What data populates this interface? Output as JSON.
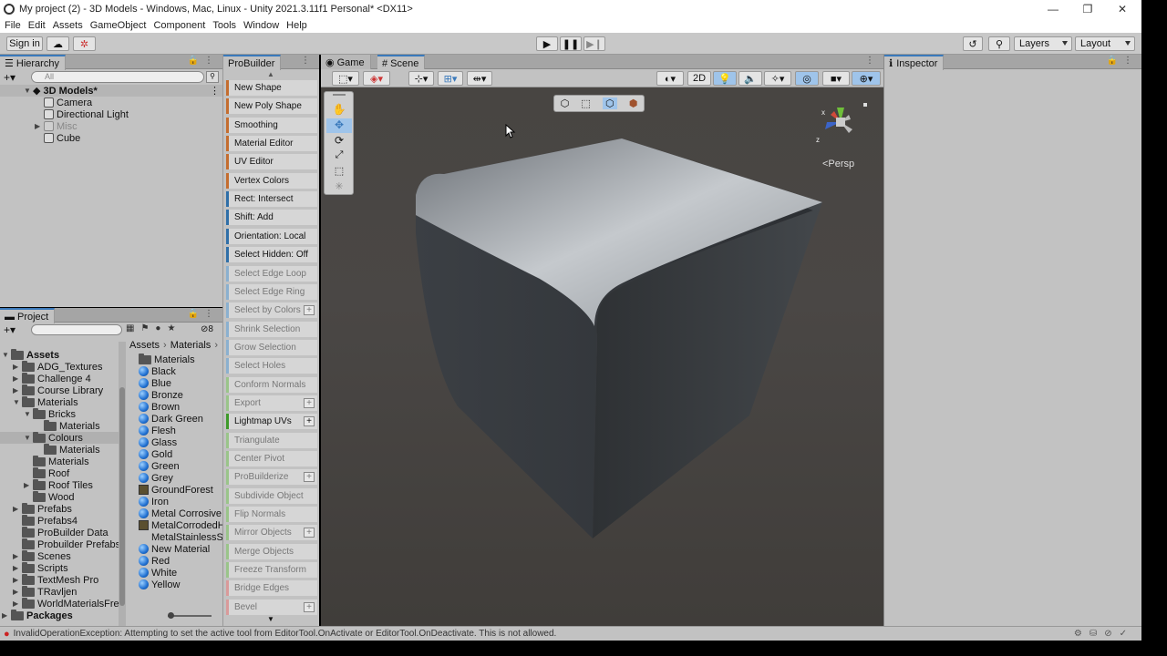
{
  "window": {
    "title": "My project (2) - 3D Models - Windows, Mac, Linux - Unity 2021.3.11f1 Personal* <DX11>",
    "controls": [
      "—",
      "❐",
      "✕"
    ]
  },
  "menu": [
    "File",
    "Edit",
    "Assets",
    "GameObject",
    "Component",
    "Tools",
    "Window",
    "Help"
  ],
  "toolbar": {
    "sign_in": "Sign in",
    "layers": "Layers",
    "layout": "Layout"
  },
  "hierarchy": {
    "tab": "Hierarchy",
    "search_placeholder": "All",
    "scene": "3D Models*",
    "items": [
      "Camera",
      "Directional Light",
      "Misc",
      "Cube"
    ]
  },
  "project": {
    "tab": "Project",
    "count_badge": "8",
    "tree": [
      {
        "label": "Assets",
        "bold": true
      },
      {
        "label": "ADG_Textures"
      },
      {
        "label": "Challenge 4"
      },
      {
        "label": "Course Library"
      },
      {
        "label": "Materials"
      },
      {
        "label": "Bricks"
      },
      {
        "label": "Materials"
      },
      {
        "label": "Colours"
      },
      {
        "label": "Materials"
      },
      {
        "label": "Materials"
      },
      {
        "label": "Roof"
      },
      {
        "label": "Roof Tiles"
      },
      {
        "label": "Wood"
      },
      {
        "label": "Prefabs"
      },
      {
        "label": "Prefabs4"
      },
      {
        "label": "ProBuilder Data"
      },
      {
        "label": "Probuilder Prefabs"
      },
      {
        "label": "Scenes"
      },
      {
        "label": "Scripts"
      },
      {
        "label": "TextMesh Pro"
      },
      {
        "label": "TRavljen"
      },
      {
        "label": "WorldMaterialsFre"
      },
      {
        "label": "Packages",
        "bold": true
      }
    ],
    "breadcrumb": [
      "Assets",
      "Materials"
    ],
    "files": [
      {
        "label": "Materials",
        "kind": "folder"
      },
      {
        "label": "Black",
        "kind": "mat"
      },
      {
        "label": "Blue",
        "kind": "mat"
      },
      {
        "label": "Bronze",
        "kind": "mat"
      },
      {
        "label": "Brown",
        "kind": "mat"
      },
      {
        "label": "Dark Green",
        "kind": "mat"
      },
      {
        "label": "Flesh",
        "kind": "mat"
      },
      {
        "label": "Glass",
        "kind": "mat"
      },
      {
        "label": "Gold",
        "kind": "mat"
      },
      {
        "label": "Green",
        "kind": "mat"
      },
      {
        "label": "Grey",
        "kind": "mat"
      },
      {
        "label": "GroundForest",
        "kind": "tex"
      },
      {
        "label": "Iron",
        "kind": "mat"
      },
      {
        "label": "Metal Corrosive",
        "kind": "mat"
      },
      {
        "label": "MetalCorrodedH",
        "kind": "tex"
      },
      {
        "label": "MetalStainlessSt",
        "kind": "none"
      },
      {
        "label": "New Material",
        "kind": "mat"
      },
      {
        "label": "Red",
        "kind": "mat"
      },
      {
        "label": "White",
        "kind": "mat"
      },
      {
        "label": "Yellow",
        "kind": "mat"
      }
    ]
  },
  "probuilder": {
    "tab": "ProBuilder",
    "buttons": [
      {
        "label": "New Shape",
        "color": "#c46d2f",
        "dim": false,
        "plus": false
      },
      {
        "label": "New Poly Shape",
        "color": "#c46d2f",
        "dim": false,
        "plus": false
      },
      {
        "label": "Smoothing",
        "color": "#c46d2f",
        "dim": false,
        "plus": false
      },
      {
        "label": "Material Editor",
        "color": "#c46d2f",
        "dim": false,
        "plus": false
      },
      {
        "label": "UV Editor",
        "color": "#c46d2f",
        "dim": false,
        "plus": false
      },
      {
        "label": "Vertex Colors",
        "color": "#c46d2f",
        "dim": false,
        "plus": false
      },
      {
        "label": "Rect: Intersect",
        "color": "#2f6fa8",
        "dim": false,
        "plus": false
      },
      {
        "label": "Shift: Add",
        "color": "#2f6fa8",
        "dim": false,
        "plus": false
      },
      {
        "label": "Orientation: Local",
        "color": "#2f6fa8",
        "dim": false,
        "plus": false
      },
      {
        "label": "Select Hidden: Off",
        "color": "#2f6fa8",
        "dim": false,
        "plus": false
      },
      {
        "label": "Select Edge Loop",
        "color": "#8bb0cf",
        "dim": true,
        "plus": false
      },
      {
        "label": "Select Edge Ring",
        "color": "#8bb0cf",
        "dim": true,
        "plus": false
      },
      {
        "label": "Select by Colors",
        "color": "#8bb0cf",
        "dim": true,
        "plus": true
      },
      {
        "label": "Shrink Selection",
        "color": "#8bb0cf",
        "dim": true,
        "plus": false
      },
      {
        "label": "Grow Selection",
        "color": "#8bb0cf",
        "dim": true,
        "plus": false
      },
      {
        "label": "Select Holes",
        "color": "#8bb0cf",
        "dim": true,
        "plus": false
      },
      {
        "label": "Conform Normals",
        "color": "#9ac48a",
        "dim": true,
        "plus": false
      },
      {
        "label": "Export",
        "color": "#9ac48a",
        "dim": true,
        "plus": true
      },
      {
        "label": "Lightmap UVs",
        "color": "#3e9a2a",
        "dim": false,
        "plus": true
      },
      {
        "label": "Triangulate",
        "color": "#9ac48a",
        "dim": true,
        "plus": false
      },
      {
        "label": "Center Pivot",
        "color": "#9ac48a",
        "dim": true,
        "plus": false
      },
      {
        "label": "ProBuilderize",
        "color": "#9ac48a",
        "dim": true,
        "plus": true
      },
      {
        "label": "Subdivide Object",
        "color": "#9ac48a",
        "dim": true,
        "plus": false
      },
      {
        "label": "Flip Normals",
        "color": "#9ac48a",
        "dim": true,
        "plus": false
      },
      {
        "label": "Mirror Objects",
        "color": "#9ac48a",
        "dim": true,
        "plus": true
      },
      {
        "label": "Merge Objects",
        "color": "#9ac48a",
        "dim": true,
        "plus": false
      },
      {
        "label": "Freeze Transform",
        "color": "#9ac48a",
        "dim": true,
        "plus": false
      },
      {
        "label": "Bridge Edges",
        "color": "#d99a9a",
        "dim": true,
        "plus": false
      },
      {
        "label": "Bevel",
        "color": "#d99a9a",
        "dim": true,
        "plus": true
      }
    ]
  },
  "scene_view": {
    "tabs": [
      "Game",
      "Scene"
    ],
    "mode_2d": "2D",
    "persp_label": "<Persp",
    "axis_labels": [
      "x",
      "z"
    ]
  },
  "inspector": {
    "tab": "Inspector"
  },
  "status": {
    "message": "InvalidOperationException: Attempting to set the active tool from EditorTool.OnActivate or EditorTool.OnDeactivate. This is not allowed."
  }
}
